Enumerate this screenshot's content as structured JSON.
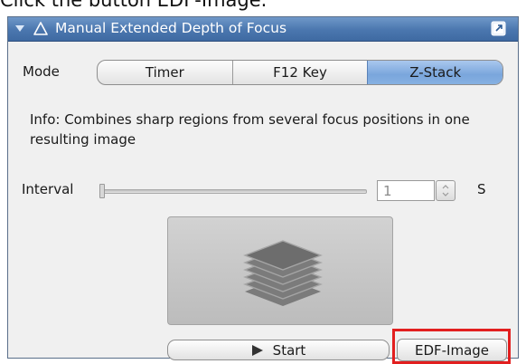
{
  "instruction": "Click the button EDF-Image.",
  "window": {
    "title": "Manual Extended Depth of Focus"
  },
  "mode": {
    "label": "Mode",
    "options": [
      "Timer",
      "F12 Key",
      "Z-Stack"
    ],
    "selected": "Z-Stack"
  },
  "info_text": "Info: Combines sharp regions from several focus positions in one resulting image",
  "interval": {
    "label": "Interval",
    "value": "1",
    "unit": "S",
    "slider_fraction": 0
  },
  "buttons": {
    "start": "Start",
    "edf_image": "EDF-Image"
  },
  "colors": {
    "title_bar": "#4a76ae",
    "selected_segment": "#86b0e2",
    "highlight": "#e21f1f",
    "panel_background": "#f0f0f0"
  },
  "icons": {
    "titlebar": [
      "collapse-arrow-icon",
      "warning-triangle-icon",
      "popout-icon"
    ],
    "preview": "image-stack-icon",
    "start": "play-icon"
  }
}
